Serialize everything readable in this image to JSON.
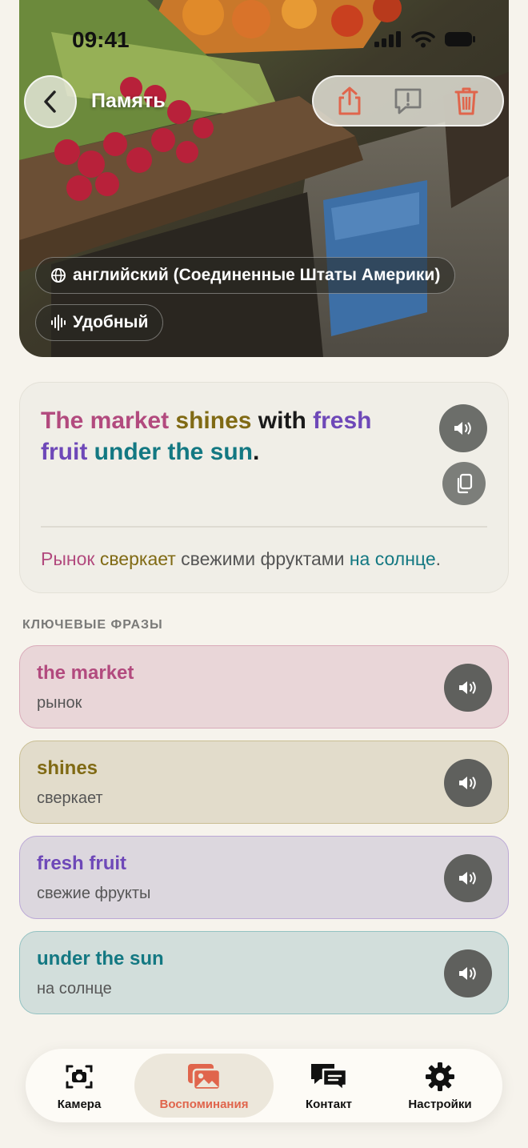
{
  "status_bar": {
    "time": "09:41"
  },
  "header": {
    "title": "Память"
  },
  "chips": {
    "language": "английский (Соединенные Штаты Америки)",
    "voice": "Удобный"
  },
  "sentence": {
    "en_parts": [
      {
        "text": "The market",
        "color": "#b24a7e"
      },
      {
        "text": " ",
        "color": "#1a1a1a"
      },
      {
        "text": "shines",
        "color": "#806a14"
      },
      {
        "text": " with ",
        "color": "#1a1a1a"
      },
      {
        "text": "fresh fruit",
        "color": "#6e48b8"
      },
      {
        "text": " ",
        "color": "#1a1a1a"
      },
      {
        "text": "under the sun",
        "color": "#137882"
      },
      {
        "text": ".",
        "color": "#1a1a1a"
      }
    ],
    "ru_parts": [
      {
        "text": "Рынок",
        "color": "#b24a7e"
      },
      {
        "text": " ",
        "color": "#555555"
      },
      {
        "text": "сверкает",
        "color": "#806a14"
      },
      {
        "text": " свежими фруктами ",
        "color": "#555555"
      },
      {
        "text": "на солнце",
        "color": "#137882"
      },
      {
        "text": ".",
        "color": "#555555"
      }
    ]
  },
  "key_phrases_label": "КЛЮЧЕВЫЕ ФРАЗЫ",
  "key_phrases": [
    {
      "en": "the market",
      "ru": "рынок",
      "color": "#b24a7e"
    },
    {
      "en": "shines",
      "ru": "сверкает",
      "color": "#806a14"
    },
    {
      "en": "fresh fruit",
      "ru": "свежие фрукты",
      "color": "#6e48b8"
    },
    {
      "en": "under the sun",
      "ru": "на солнце",
      "color": "#137882"
    }
  ],
  "tabs": {
    "camera": "Камера",
    "memories": "Воспоминания",
    "contact": "Контакт",
    "settings": "Настройки"
  },
  "colors": {
    "accent": "#e0654c",
    "background": "#f6f3ec"
  },
  "icons": [
    "chevron-left-icon",
    "share-icon",
    "report-icon",
    "trash-icon",
    "globe-icon",
    "waveform-icon",
    "speaker-icon",
    "copy-icon",
    "camera-icon",
    "photos-icon",
    "chat-icon",
    "gear-icon"
  ]
}
